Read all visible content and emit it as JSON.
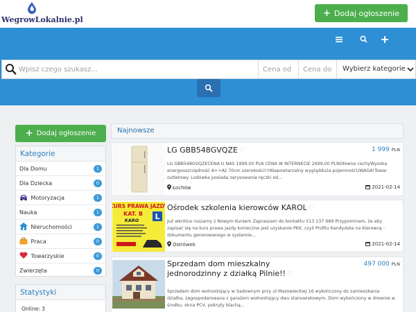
{
  "site": {
    "logo_text": "WegrowLokalnie.pl"
  },
  "header": {
    "add_listing_label": "Dodaj ogłoszenie",
    "menu_icon": "menu-icon",
    "search_icon": "search-icon",
    "plus_icon": "plus-icon"
  },
  "search": {
    "placeholder": "Wpisz czego szukasz...",
    "price_from_placeholder": "Cena od",
    "price_to_placeholder": "Cena do",
    "category_selected": "Wybierz kategorie"
  },
  "sidebar": {
    "add_listing_label": "Dodaj ogłoszenie",
    "categories_title": "Kategorie",
    "categories": [
      {
        "label": "Dla Domu",
        "count": "1",
        "icon": ""
      },
      {
        "label": "Dla Dziecka",
        "count": "0",
        "icon": ""
      },
      {
        "label": "Motoryzacja",
        "count": "1",
        "icon": "car-icon"
      },
      {
        "label": "Nauka",
        "count": "1",
        "icon": ""
      },
      {
        "label": "Nieruchomości",
        "count": "1",
        "icon": "house-icon"
      },
      {
        "label": "Praca",
        "count": "0",
        "icon": "briefcase-icon"
      },
      {
        "label": "Towarzyskie",
        "count": "0",
        "icon": "heart-icon"
      },
      {
        "label": "Zwierzęta",
        "count": "0",
        "icon": ""
      }
    ],
    "stats_title": "Statystyki",
    "online_label": "Online: 3"
  },
  "main": {
    "newest_title": "Najnowsze",
    "listings": [
      {
        "title": "LG GBB548GVQZE",
        "price": "1 999",
        "currency": "PLN",
        "description": "LG GBB548GVQZECENA U NAS 1999,00 PLN CENA W INTERNECIE 2699,00 PLNGłówne cechyWysoka energooszczędność A++Aż 70cm szerokości!!!Niepowtarzalny wyglądduża pojemnośćUWAGA!Towar outletowy. Lodówka posiada zarysowania ręczki od...",
        "location": "Łochów",
        "date": "2021-02-14"
      },
      {
        "title": "Ośrodek szkolenia kierowców KAROL",
        "price": "",
        "currency": "",
        "description": "Już wkrótce ruszamy z Nowym Kursem  Zapraszam do kontaktu 513 137 989 Przypominam, że aby zapisać się na kurs prawa jazdy konieczne jest uzyskanie PKK, czyli Profilu Kandydata na Kierowcę - dokumentu generowanego w systemie...",
        "location": "Ostrówek",
        "date": "2021-02-14"
      },
      {
        "title": "Sprzedam dom mieszkalny jednorodzinny z działką Pilnie!!",
        "price": "497 000",
        "currency": "PLN",
        "description": "Sprzedam dom wolnostojący w Sadownym przy ul Mazowieckiej 16 wykończony do zamieszkania działka, zagospodarowana z garażem wolnostojący dwu stanowiskowym. Dom wykończony w drewnie w środku, okna PCV, pokryty blachą...",
        "location": "",
        "date": ""
      }
    ],
    "thumb_texts": {
      "school_header": "KURS PRAWA JAZDY",
      "school_category": "KAT. B",
      "school_name": "KARO",
      "school_badge": "L"
    }
  },
  "colors": {
    "brand_blue": "#2e8fd5",
    "green": "#4cae4c",
    "link_blue": "#2b7fbf"
  }
}
